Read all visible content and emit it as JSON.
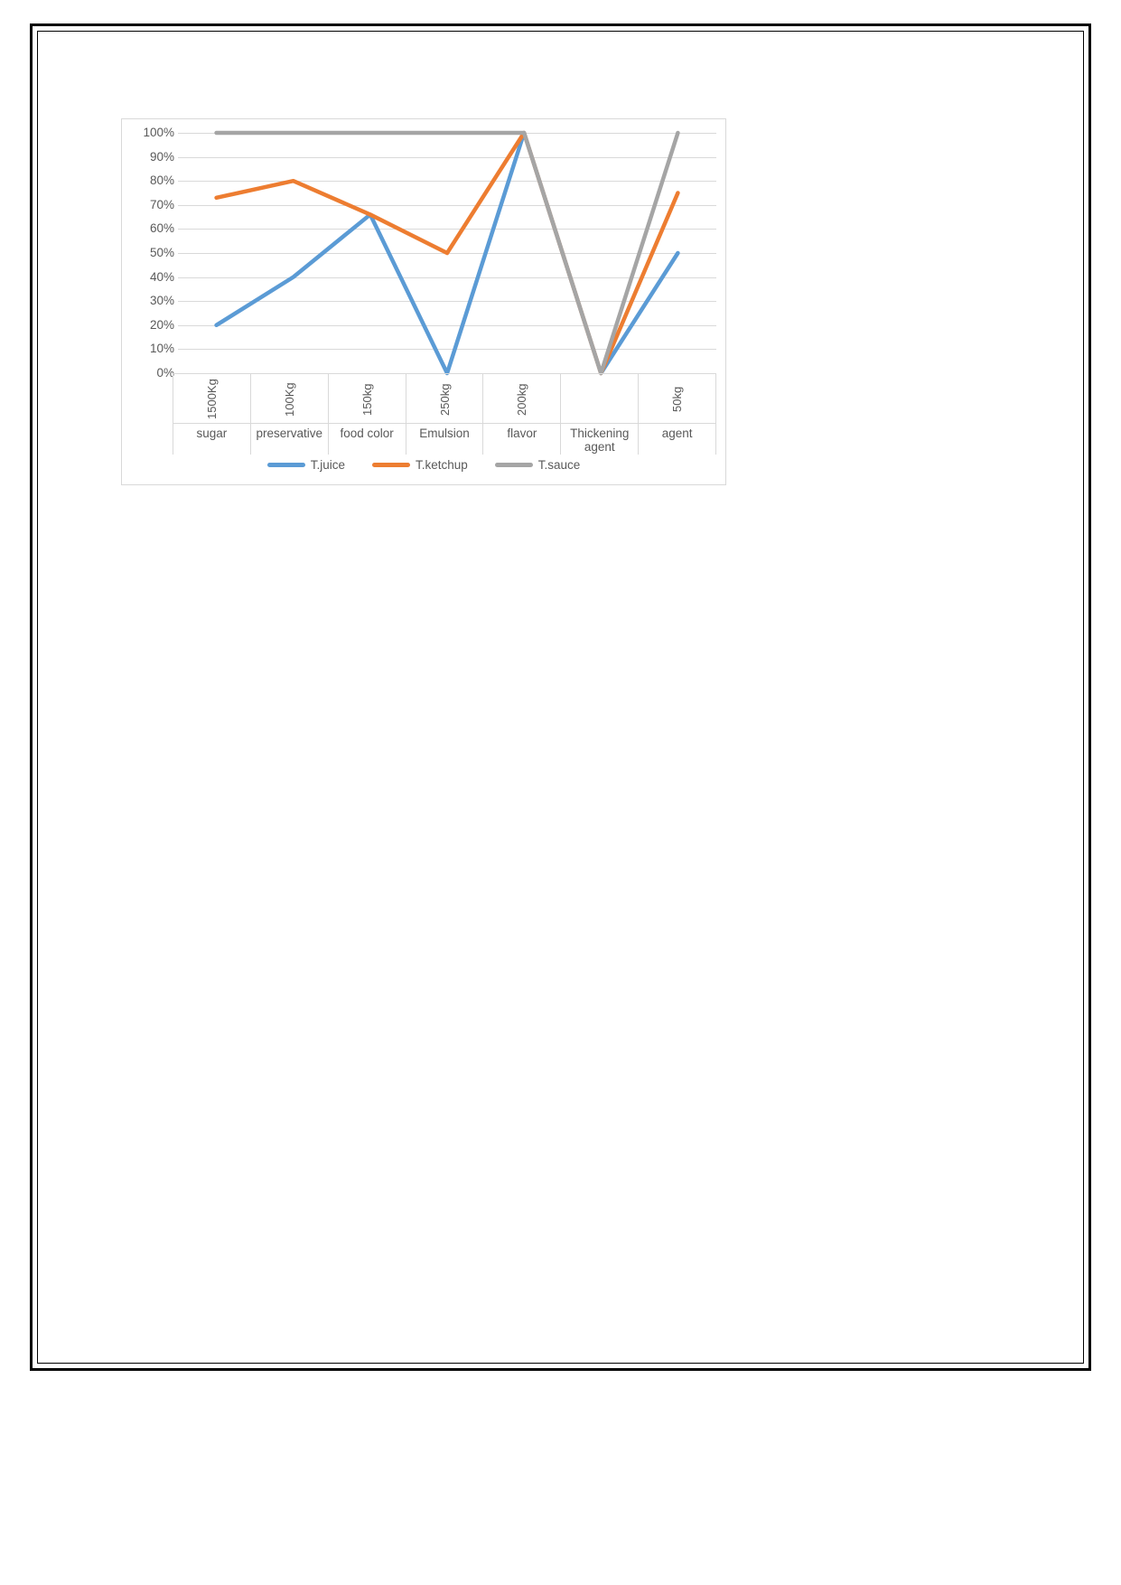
{
  "chart_data": {
    "type": "line",
    "title": "",
    "xlabel": "",
    "ylabel": "",
    "ylim": [
      0,
      100
    ],
    "ytick_labels": [
      "100%",
      "90%",
      "80%",
      "70%",
      "60%",
      "50%",
      "40%",
      "30%",
      "20%",
      "10%",
      "0%"
    ],
    "ytick_values": [
      100,
      90,
      80,
      70,
      60,
      50,
      40,
      30,
      20,
      10,
      0
    ],
    "grid": true,
    "legend_position": "bottom",
    "categories": [
      "1500Kg",
      "100Kg",
      "150kg",
      "250kg",
      "200kg",
      "",
      "50kg"
    ],
    "category_names": [
      "sugar",
      "preservative",
      "food color",
      "Emulsion",
      "flavor",
      "Thickening agent",
      "agent"
    ],
    "series": [
      {
        "name": "T.juice",
        "color": "#5B9BD5",
        "values": [
          20,
          40,
          66,
          0,
          100,
          0,
          50
        ]
      },
      {
        "name": "T.ketchup",
        "color": "#ED7D31",
        "values": [
          73,
          80,
          66,
          50,
          100,
          0,
          75
        ]
      },
      {
        "name": "T.sauce",
        "color": "#A5A5A5",
        "values": [
          100,
          100,
          100,
          100,
          100,
          0,
          100
        ]
      }
    ]
  },
  "colors": {
    "gridline": "#D9D9D9",
    "axis_text": "#595959",
    "chart_border": "#D9D9D9",
    "page_border": "#000000"
  }
}
